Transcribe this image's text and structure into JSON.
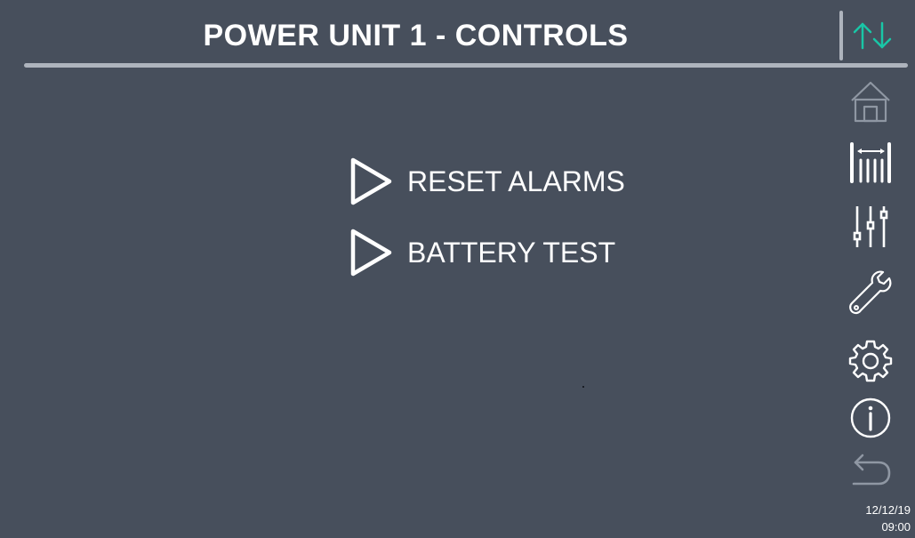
{
  "header": {
    "title": "POWER UNIT 1 - CONTROLS"
  },
  "menu": {
    "items": [
      {
        "label": "RESET ALARMS"
      },
      {
        "label": "BATTERY TEST"
      }
    ]
  },
  "sidebar": {
    "status_icon": "communication-arrows-icon",
    "items": [
      {
        "icon": "home-icon",
        "state": "disabled"
      },
      {
        "icon": "meter-icon",
        "state": "enabled"
      },
      {
        "icon": "sliders-icon",
        "state": "enabled"
      },
      {
        "icon": "wrench-icon",
        "state": "enabled"
      },
      {
        "icon": "gear-icon",
        "state": "enabled"
      },
      {
        "icon": "info-icon",
        "state": "enabled"
      },
      {
        "icon": "back-arrow-icon",
        "state": "disabled"
      }
    ]
  },
  "status": {
    "date": "12/12/19",
    "time": "09:00"
  },
  "colors": {
    "background": "#474f5c",
    "text": "#ffffff",
    "accent": "#19c6a6",
    "disabled": "#8f97a3",
    "rule": "#aeb4bd"
  }
}
